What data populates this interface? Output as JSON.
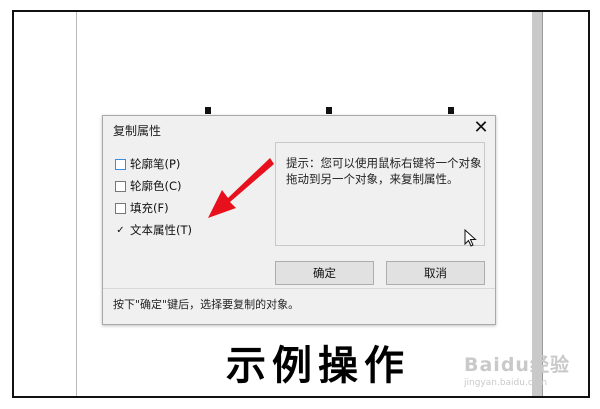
{
  "dialog": {
    "title": "复制属性",
    "close_symbol": "✕",
    "options": [
      {
        "label": "轮廓笔(P)",
        "checked": false,
        "focused": true
      },
      {
        "label": "轮廓色(C)",
        "checked": false,
        "focused": false
      },
      {
        "label": "填充(F)",
        "checked": false,
        "focused": false
      },
      {
        "label": "文本属性(T)",
        "checked": true,
        "focused": false
      }
    ],
    "check_mark": "✓",
    "hint": "提示：您可以使用鼠标右键将一个对象拖动到另一个对象，来复制属性。",
    "ok_label": "确定",
    "cancel_label": "取消",
    "status": "按下\"确定\"键后，选择要复制的对象。"
  },
  "caption": "示例操作",
  "watermark": {
    "main": "Baidu经验",
    "sub": "jingyan.baidu.com"
  },
  "colors": {
    "arrow": "#e8101c",
    "dialog_bg": "#f0f0f0",
    "focus_border": "#3c8edc"
  },
  "icons": [
    "close-icon",
    "arrow-annotation-icon",
    "mouse-cursor-icon",
    "check-icon"
  ]
}
